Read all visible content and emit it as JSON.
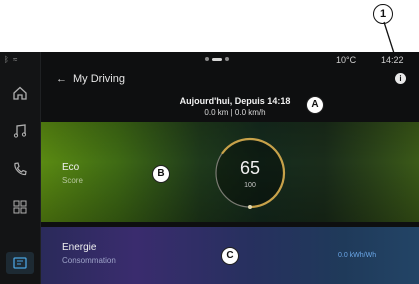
{
  "status": {
    "temperature": "10°C",
    "time": "14:22",
    "left_icons": "ᛒ ≈"
  },
  "header": {
    "back_arrow": "←",
    "title": "My Driving",
    "info": "i"
  },
  "summary": {
    "line1": "Aujourd'hui, Depuis 14:18",
    "line2": "0.0 km | 0.0 km/h"
  },
  "eco": {
    "label": "Eco",
    "sublabel": "Score",
    "score": "65",
    "max": "100",
    "score_fraction": 0.65
  },
  "energy": {
    "label": "Energie",
    "sublabel": "Consommation",
    "value": "0.0 kWh/Wh"
  },
  "sidebar": {
    "items": [
      "home-icon",
      "music-icon",
      "phone-icon",
      "apps-icon",
      "vehicle-icon"
    ]
  },
  "callouts": {
    "A": "A",
    "B": "B",
    "C": "C",
    "one": "1"
  }
}
